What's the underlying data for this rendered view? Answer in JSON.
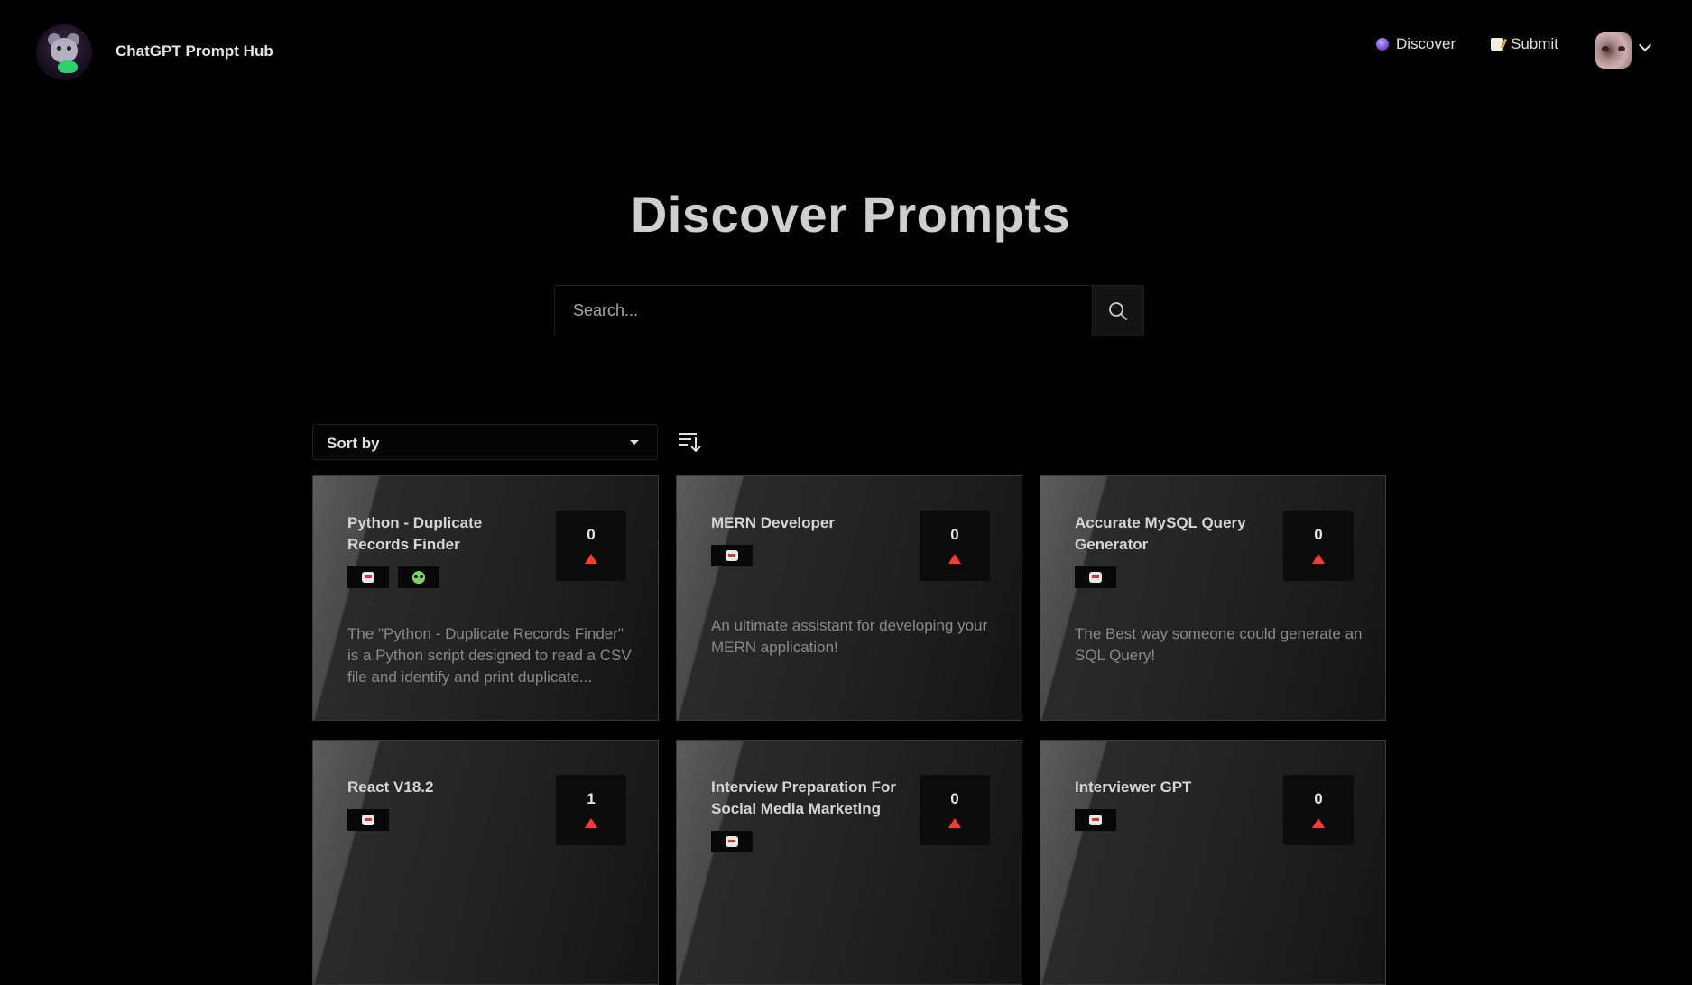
{
  "header": {
    "brand": "ChatGPT Prompt Hub",
    "nav": [
      {
        "label": "Discover",
        "icon": "crystal-ball-icon"
      },
      {
        "label": "Submit",
        "icon": "memo-icon"
      }
    ]
  },
  "main": {
    "title": "Discover Prompts",
    "search": {
      "placeholder": "Search...",
      "value": ""
    },
    "sort": {
      "label": "Sort by"
    }
  },
  "cards": [
    {
      "title": "Python - Duplicate Records Finder",
      "votes": "0",
      "tags": [
        "robot-icon",
        "alien-icon"
      ],
      "description": "The \"Python - Duplicate Records Finder\" is a Python script designed to read a CSV file and identify and print duplicate..."
    },
    {
      "title": "MERN Developer",
      "votes": "0",
      "tags": [
        "robot-icon"
      ],
      "description": "An ultimate assistant for developing your MERN application!"
    },
    {
      "title": "Accurate MySQL Query Generator",
      "votes": "0",
      "tags": [
        "robot-icon"
      ],
      "description": "The Best way someone could generate an SQL Query!"
    },
    {
      "title": "React V18.2",
      "votes": "1",
      "tags": [
        "robot-icon"
      ],
      "description": ""
    },
    {
      "title": "Interview Preparation For Social Media Marketing",
      "votes": "0",
      "tags": [
        "robot-icon"
      ],
      "description": ""
    },
    {
      "title": "Interviewer GPT",
      "votes": "0",
      "tags": [
        "robot-icon"
      ],
      "description": ""
    }
  ],
  "colors": {
    "background": "#000000",
    "upvote": "#ff3b2f"
  }
}
